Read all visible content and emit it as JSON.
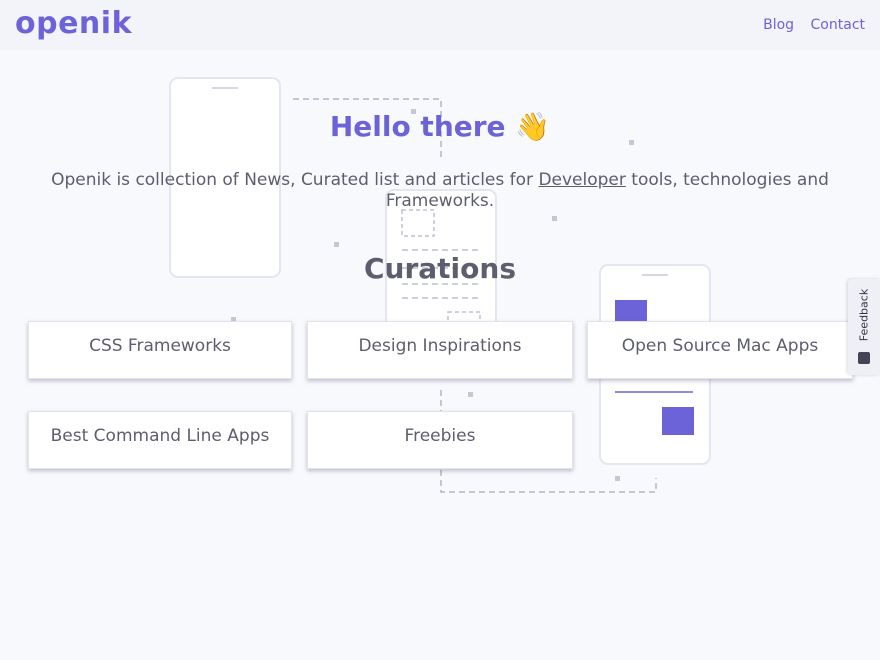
{
  "header": {
    "logo": "openik",
    "nav": [
      {
        "label": "Blog"
      },
      {
        "label": "Contact"
      }
    ]
  },
  "hero": {
    "title": "Hello there 👋",
    "description_before": "Openik is collection of News, Curated list and articles for ",
    "description_link": "Developer",
    "description_after": " tools, technologies and Frameworks."
  },
  "curations": {
    "title": "Curations",
    "items": [
      {
        "label": "CSS Frameworks"
      },
      {
        "label": "Design Inspirations"
      },
      {
        "label": "Open Source Mac Apps"
      },
      {
        "label": "Best Command Line Apps"
      },
      {
        "label": "Freebies"
      }
    ]
  },
  "feedback": {
    "label": "Feedback"
  },
  "colors": {
    "brand": "#6c63d9",
    "text": "#5d5d70",
    "background": "#f8f9fc"
  }
}
